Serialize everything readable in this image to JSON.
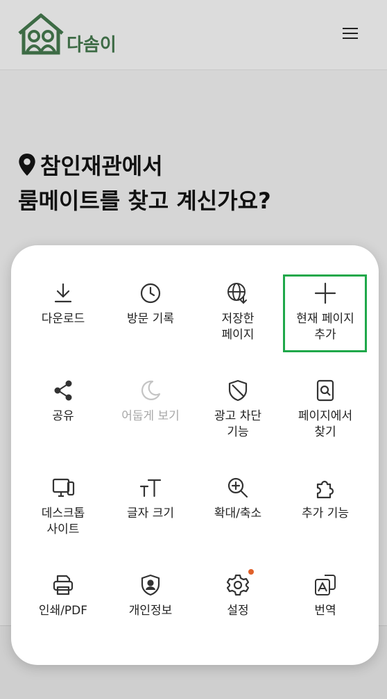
{
  "brand": {
    "name": "다솜이"
  },
  "hero": {
    "line1": "참인재관에서",
    "line2": "룸메이트를 찾고 계신가요?"
  },
  "menu": {
    "items": [
      {
        "label": "다운로드",
        "icon": "download-icon",
        "enabled": true
      },
      {
        "label": "방문 기록",
        "icon": "clock-icon",
        "enabled": true
      },
      {
        "label": "저장한\n페이지",
        "icon": "saved-globe-icon",
        "enabled": true
      },
      {
        "label": "현재 페이지\n추가",
        "icon": "plus-icon",
        "enabled": true,
        "highlighted": true
      },
      {
        "label": "공유",
        "icon": "share-icon",
        "enabled": true
      },
      {
        "label": "어둡게 보기",
        "icon": "moon-icon",
        "enabled": false
      },
      {
        "label": "광고 차단\n기능",
        "icon": "shield-icon",
        "enabled": true
      },
      {
        "label": "페이지에서\n찾기",
        "icon": "find-in-page-icon",
        "enabled": true
      },
      {
        "label": "데스크톱\n사이트",
        "icon": "desktop-icon",
        "enabled": true
      },
      {
        "label": "글자 크기",
        "icon": "text-size-icon",
        "enabled": true
      },
      {
        "label": "확대/축소",
        "icon": "zoom-icon",
        "enabled": true
      },
      {
        "label": "추가 기능",
        "icon": "puzzle-icon",
        "enabled": true
      },
      {
        "label": "인쇄/PDF",
        "icon": "printer-icon",
        "enabled": true
      },
      {
        "label": "개인정보",
        "icon": "privacy-shield-icon",
        "enabled": true
      },
      {
        "label": "설정",
        "icon": "gear-icon",
        "enabled": true,
        "badge": true
      },
      {
        "label": "번역",
        "icon": "translate-icon",
        "enabled": true
      }
    ]
  },
  "colors": {
    "brand": "#3d6b45",
    "highlight": "#1fa84a",
    "badge": "#e0612a"
  }
}
